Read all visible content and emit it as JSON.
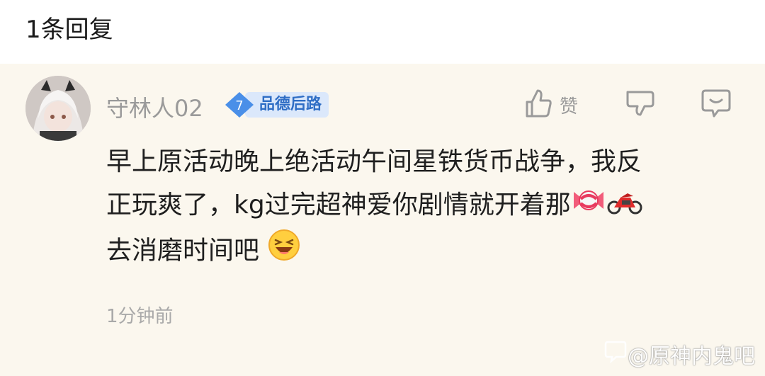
{
  "header": {
    "reply_count": "1条回复"
  },
  "comment": {
    "username": "守林人02",
    "level": "7",
    "level_title": "品德后路",
    "like_label": "赞",
    "line1": "早上原活动晚上绝活动午间星铁货币战争，我反",
    "line2": "正玩爽了，kg过完超神爱你剧情就开着那",
    "line3": "去消磨时间吧",
    "time": "1分钟前",
    "emojis": [
      "candy-emoji",
      "motorcycle-emoji",
      "laughing-face-emoji"
    ]
  },
  "watermark": {
    "text": "@原神内鬼吧"
  },
  "colors": {
    "card_bg": "#fbf7ee",
    "level_blue": "#2f6ec5",
    "level_bg": "#dbe8fb",
    "muted": "#9a9a9a"
  }
}
